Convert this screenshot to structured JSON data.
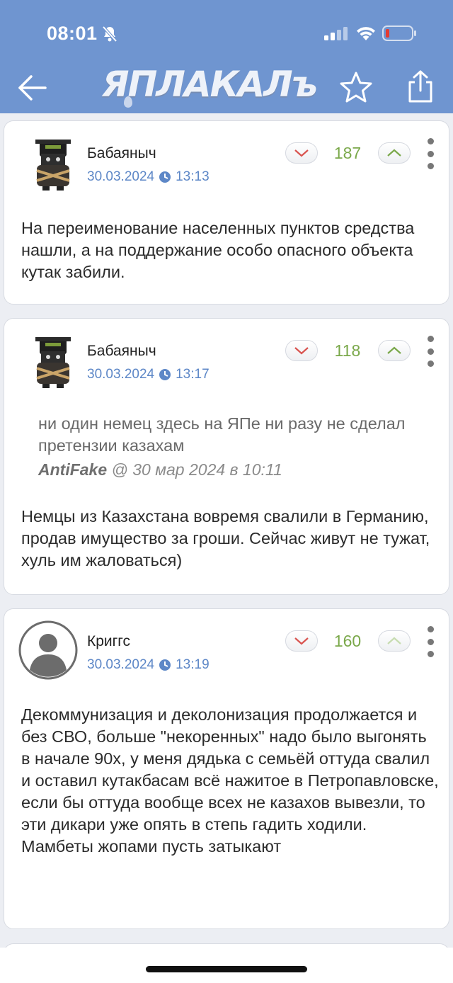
{
  "status_bar": {
    "time": "08:01"
  },
  "header": {
    "logo": "ЯПЛАКАЛъ"
  },
  "posts": [
    {
      "author": "Бабаяныч",
      "date": "30.03.2024",
      "time": "13:13",
      "score": "187",
      "text": "На переименование населенных пунктов средства нашли, а на поддержание особо опасного объекта кутак забили."
    },
    {
      "author": "Бабаяныч",
      "date": "30.03.2024",
      "time": "13:17",
      "score": "118",
      "quote": {
        "text": "ни один немец здесь на ЯПе ни разу не сделал претензии казахам",
        "author": "AntiFake",
        "meta": "@ 30 мар 2024 в 10:11"
      },
      "text": "Немцы из Казахстана вовремя свалили в Германию, продав имущество за гроши. Сейчас живут не тужат, хуль им жаловаться)"
    },
    {
      "author": "Криггс",
      "date": "30.03.2024",
      "time": "13:19",
      "score": "160",
      "text": "Декоммунизация и деколонизация продолжается и без СВО, больше \"некоренных\" надо было выгонять в начале 90х, у меня дядька с семьёй оттуда свалил и оставил кутакбасам всё нажитое в Петропавловске, если бы оттуда вообще всех не казахов вывезли, то эти дикари уже опять в степь гадить ходили. Мамбеты жопами пусть затыкают"
    }
  ],
  "colors": {
    "header_bg": "#6f95d0",
    "date": "#5d87c7",
    "score": "#7aa84a",
    "downvote": "#d9534f"
  }
}
